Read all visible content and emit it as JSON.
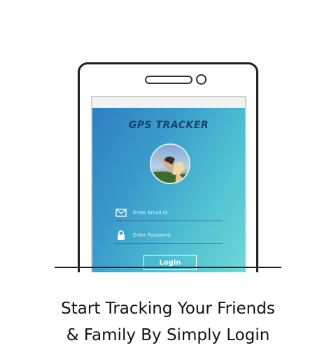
{
  "app": {
    "title": "GPS TRACKER",
    "email_placeholder": "Enter Email Id",
    "password_placeholder": "Enter Password",
    "login_label": "Login"
  },
  "caption": {
    "line1": "Start Tracking Your Friends",
    "line2": "& Family By Simply Login"
  },
  "icons": {
    "email": "envelope-icon",
    "password": "lock-icon"
  },
  "colors": {
    "gradient_start": "#2d7fbf",
    "gradient_end": "#6fd8d6",
    "title": "#17436b"
  }
}
